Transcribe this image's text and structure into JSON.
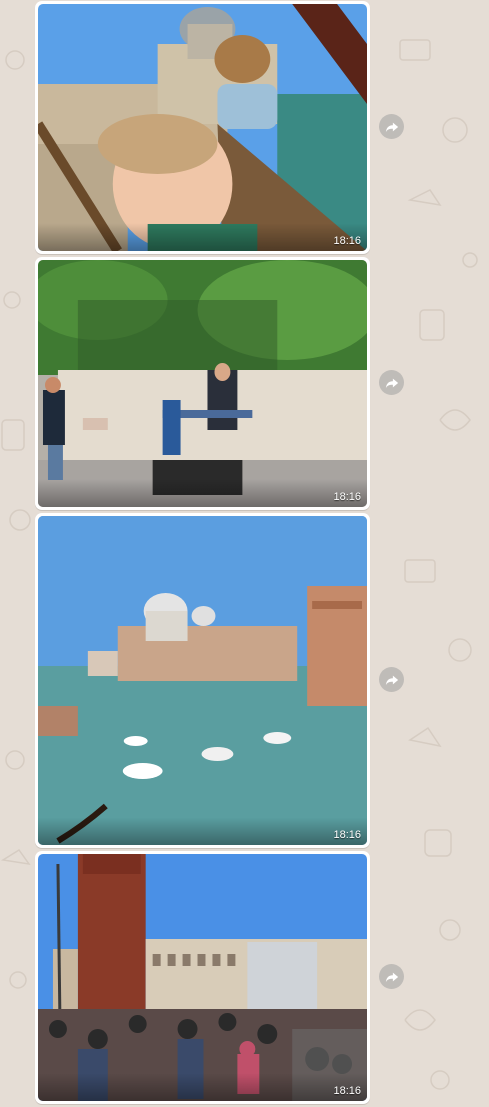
{
  "chat": {
    "messages": [
      {
        "kind": "image",
        "subject": "girl with teddy bear at venice",
        "time": "18:16"
      },
      {
        "kind": "image",
        "subject": "street musician playing glasses",
        "time": "18:16"
      },
      {
        "kind": "image",
        "subject": "grand canal with basilica",
        "time": "18:16"
      },
      {
        "kind": "image",
        "subject": "campanile and crowded piazza",
        "time": "18:16"
      }
    ],
    "forward_icon": "forward-arrow-icon"
  },
  "colors": {
    "wallpaper": "#e5ddd5",
    "bubble": "#ffffff",
    "sky": "#4a8fd6",
    "water": "#5a9ea0"
  }
}
